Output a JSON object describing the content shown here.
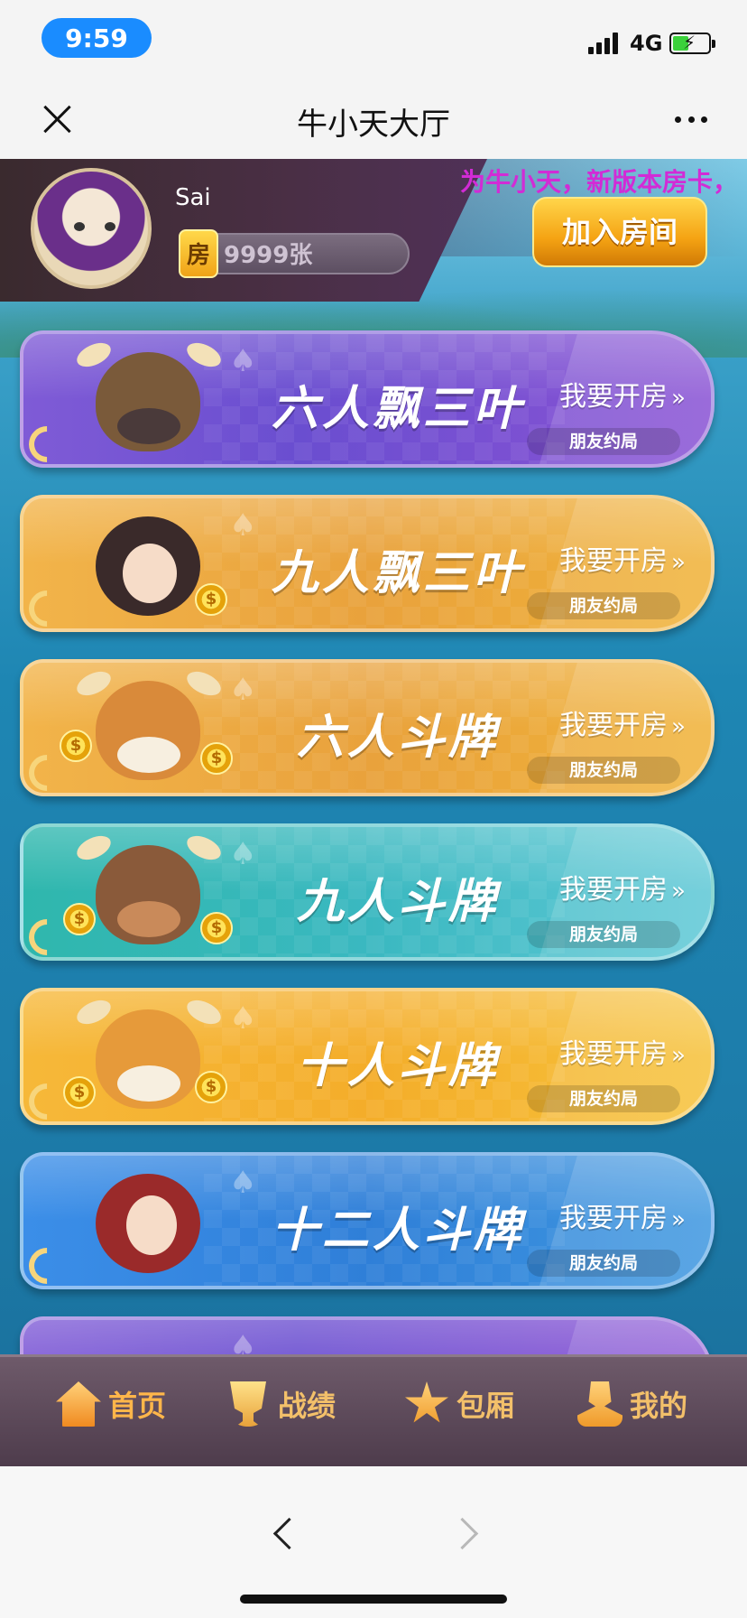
{
  "status_bar": {
    "time": "9:59",
    "network": "4G",
    "battery_level": 0.45
  },
  "nav": {
    "title": "牛小天大厅"
  },
  "header": {
    "username": "Sai",
    "room_card_icon_label": "房",
    "room_card_count": "9999张",
    "marquee": "为牛小天，新版本房卡，",
    "join_button": "加入房间"
  },
  "banners": [
    {
      "title": "六人飘三叶",
      "cta": "我要开房",
      "sub": "朋友约局",
      "color": "#6a4ed0"
    },
    {
      "title": "九人飘三叶",
      "cta": "我要开房",
      "sub": "朋友约局",
      "color": "#e9a23c"
    },
    {
      "title": "六人斗牌",
      "cta": "我要开房",
      "sub": "朋友约局",
      "color": "#e9a23c"
    },
    {
      "title": "九人斗牌",
      "cta": "我要开房",
      "sub": "朋友约局",
      "color": "#3ab8c0"
    },
    {
      "title": "十人斗牌",
      "cta": "我要开房",
      "sub": "朋友约局",
      "color": "#f4ad2a"
    },
    {
      "title": "十二人斗牌",
      "cta": "我要开房",
      "sub": "朋友约局",
      "color": "#2f7fd8"
    }
  ],
  "tabbar": {
    "items": [
      {
        "label": "首页",
        "icon": "home-icon"
      },
      {
        "label": "战绩",
        "icon": "trophy-icon"
      },
      {
        "label": "包厢",
        "icon": "star-icon"
      },
      {
        "label": "我的",
        "icon": "user-icon"
      }
    ]
  }
}
